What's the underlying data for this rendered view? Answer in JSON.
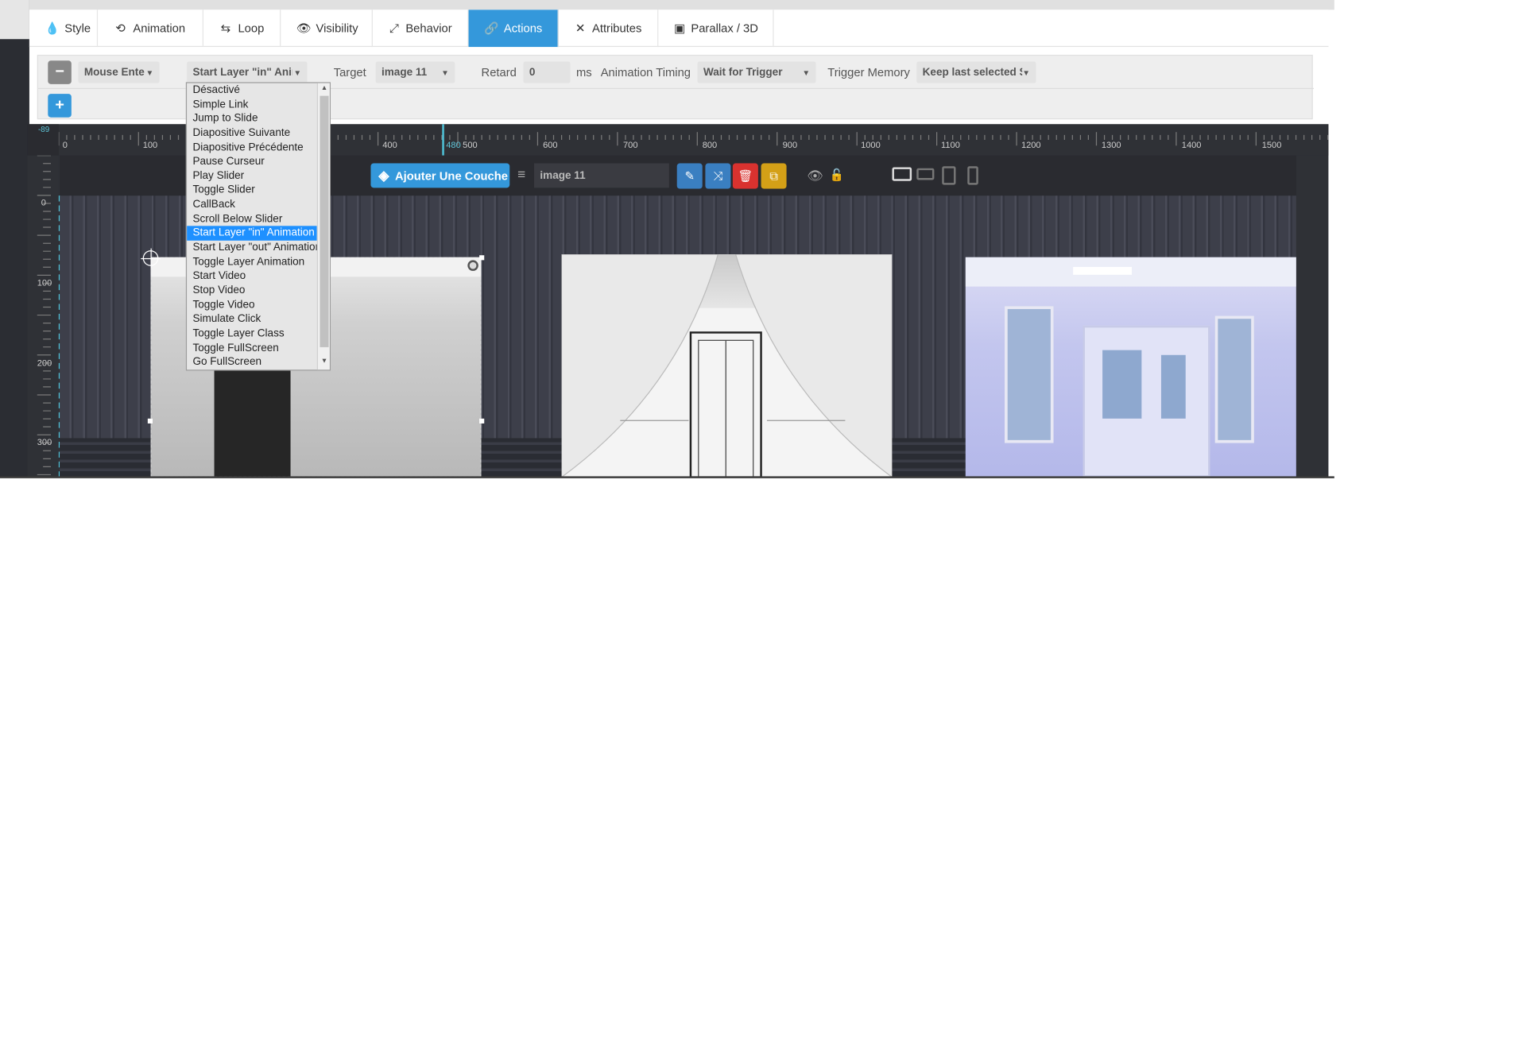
{
  "tabs": [
    {
      "label": "Style",
      "icon": "drop-icon",
      "active": false
    },
    {
      "label": "Animation",
      "icon": "history-icon",
      "active": false
    },
    {
      "label": "Loop",
      "icon": "loop-icon",
      "active": false
    },
    {
      "label": "Visibility",
      "icon": "eye-icon",
      "active": false
    },
    {
      "label": "Behavior",
      "icon": "resize-icon",
      "active": false
    },
    {
      "label": "Actions",
      "icon": "link-icon",
      "active": true
    },
    {
      "label": "Attributes",
      "icon": "tools-icon",
      "active": false
    },
    {
      "label": "Parallax / 3D",
      "icon": "image-icon",
      "active": false
    }
  ],
  "action": {
    "remove_label": "−",
    "add_label": "+",
    "event_value": "Mouse Enter",
    "action_value": "Start Layer \"in\" Animation",
    "target_label": "Target",
    "target_value": "image 11",
    "delay_label": "Retard",
    "delay_value": "0",
    "delay_unit": "ms",
    "timing_label": "Animation Timing",
    "timing_value": "Wait for Trigger",
    "memory_label": "Trigger Memory",
    "memory_value": "Keep last selected State"
  },
  "dropdown": {
    "items": [
      "Désactivé",
      "Simple Link",
      "Jump to Slide",
      "Diapositive Suivante",
      "Diapositive Précédente",
      "Pause Curseur",
      "Play Slider",
      "Toggle Slider",
      "CallBack",
      "Scroll Below Slider",
      "Start Layer \"in\" Animation",
      "Start Layer \"out\" Animation",
      "Toggle Layer Animation",
      "Start Video",
      "Stop Video",
      "Toggle Video",
      "Simulate Click",
      "Toggle Layer Class",
      "Toggle FullScreen",
      "Go FullScreen"
    ],
    "selected_index": 10
  },
  "ruler": {
    "h_labels": [
      "0",
      "100",
      "400",
      "480",
      "500",
      "600",
      "700",
      "800",
      "900",
      "1000",
      "1100",
      "1200",
      "1300",
      "1400",
      "1500"
    ],
    "corner_value": "-89",
    "v_labels": [
      "0",
      "100",
      "200",
      "300"
    ]
  },
  "layer_toolbar": {
    "add_layer_label": "Ajouter Une Couche",
    "layer_name": "image 11"
  },
  "colors": {
    "accent": "#3498db",
    "selected_item": "#1e90ff",
    "edit_btn": "#3a7fc1",
    "duplicate_btn": "#3a7fc1",
    "delete_btn": "#d9322f",
    "copy_btn": "#d4a017"
  }
}
